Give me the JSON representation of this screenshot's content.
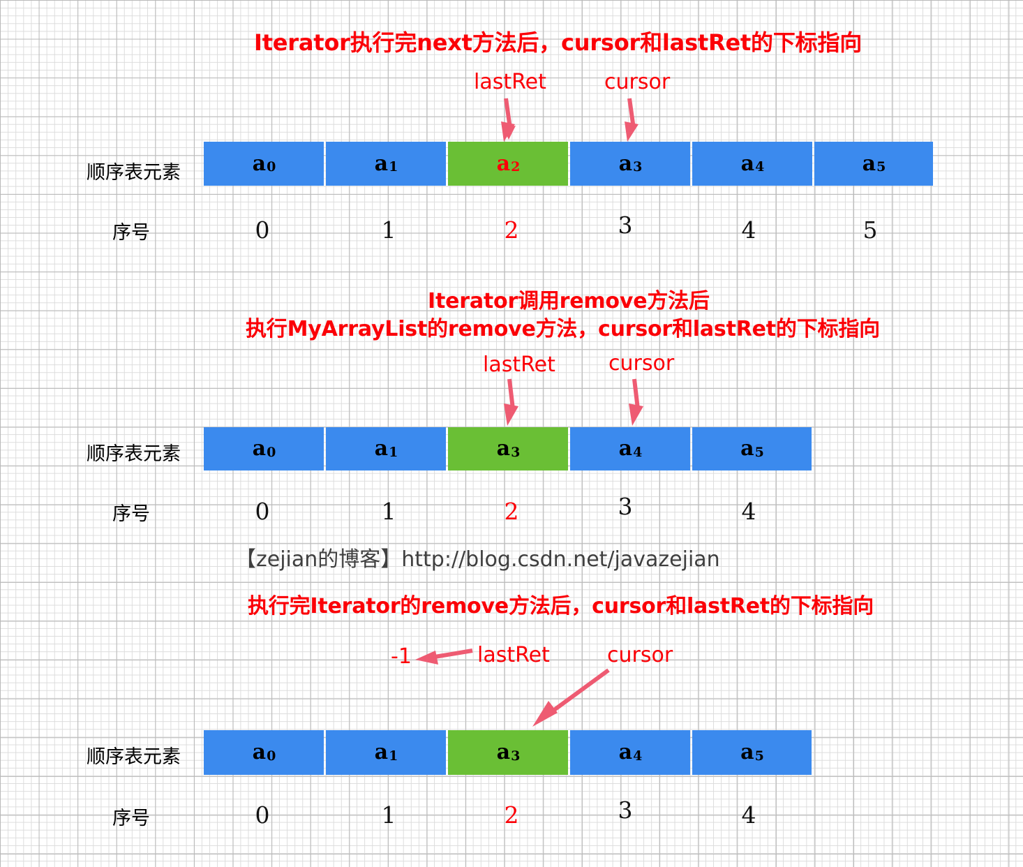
{
  "page": {
    "background": "graph-paper",
    "grid_color": "#dcdcdc",
    "grid_major_color": "#b9b9b9"
  },
  "colors": {
    "red_text": "#fb0007",
    "arrow": "#ee5b72",
    "cell_blue": "#3b8aee",
    "cell_green": "#6abf35",
    "label_black": "#000000",
    "credit_gray": "#3f3f3f"
  },
  "credit": {
    "text": "【zejian的博客】http://blog.csdn.net/javazejian"
  },
  "labels": {
    "elements_row": "顺序表元素",
    "index_row": "序号",
    "lastRet": "lastRet",
    "cursor": "cursor",
    "minus_one": "-1"
  },
  "sections": [
    {
      "id": "after-next",
      "heading_lines": [
        "Iterator执行完next方法后，cursor和lastRet的下标指向"
      ],
      "pointers": [
        {
          "name": "lastRet",
          "label": "lastRet",
          "target_index": 2
        },
        {
          "name": "cursor",
          "label": "cursor",
          "target_index": 3
        }
      ],
      "cells": [
        {
          "base": "a",
          "sub": "0",
          "color": "blue",
          "text_color": "black"
        },
        {
          "base": "a",
          "sub": "1",
          "color": "blue",
          "text_color": "black"
        },
        {
          "base": "a",
          "sub": "2",
          "color": "green",
          "text_color": "red"
        },
        {
          "base": "a",
          "sub": "3",
          "color": "blue",
          "text_color": "black"
        },
        {
          "base": "a",
          "sub": "4",
          "color": "blue",
          "text_color": "black"
        },
        {
          "base": "a",
          "sub": "5",
          "color": "blue",
          "text_color": "black"
        }
      ],
      "indices": [
        {
          "value": "0",
          "color": "black"
        },
        {
          "value": "1",
          "color": "black"
        },
        {
          "value": "2",
          "color": "red"
        },
        {
          "value": "3",
          "color": "black"
        },
        {
          "value": "4",
          "color": "black"
        },
        {
          "value": "5",
          "color": "black"
        }
      ]
    },
    {
      "id": "after-arraylist-remove",
      "heading_lines": [
        "Iterator调用remove方法后",
        "执行MyArrayList的remove方法，cursor和lastRet的下标指向"
      ],
      "pointers": [
        {
          "name": "lastRet",
          "label": "lastRet",
          "target_index": 2
        },
        {
          "name": "cursor",
          "label": "cursor",
          "target_index": 3
        }
      ],
      "cells": [
        {
          "base": "a",
          "sub": "0",
          "color": "blue",
          "text_color": "black"
        },
        {
          "base": "a",
          "sub": "1",
          "color": "blue",
          "text_color": "black"
        },
        {
          "base": "a",
          "sub": "3",
          "color": "green",
          "text_color": "black"
        },
        {
          "base": "a",
          "sub": "4",
          "color": "blue",
          "text_color": "black"
        },
        {
          "base": "a",
          "sub": "5",
          "color": "blue",
          "text_color": "black"
        }
      ],
      "indices": [
        {
          "value": "0",
          "color": "black"
        },
        {
          "value": "1",
          "color": "black"
        },
        {
          "value": "2",
          "color": "red"
        },
        {
          "value": "3",
          "color": "black"
        },
        {
          "value": "4",
          "color": "black"
        }
      ]
    },
    {
      "id": "after-iterator-remove",
      "heading_lines": [
        "执行完Iterator的remove方法后，cursor和lastRet的下标指向"
      ],
      "pointers": [
        {
          "name": "lastRet",
          "label": "lastRet",
          "target_value": "-1"
        },
        {
          "name": "cursor",
          "label": "cursor",
          "target_index": 2
        }
      ],
      "cells": [
        {
          "base": "a",
          "sub": "0",
          "color": "blue",
          "text_color": "black"
        },
        {
          "base": "a",
          "sub": "1",
          "color": "blue",
          "text_color": "black"
        },
        {
          "base": "a",
          "sub": "3",
          "color": "green",
          "text_color": "black"
        },
        {
          "base": "a",
          "sub": "4",
          "color": "blue",
          "text_color": "black"
        },
        {
          "base": "a",
          "sub": "5",
          "color": "blue",
          "text_color": "black"
        }
      ],
      "indices": [
        {
          "value": "0",
          "color": "black"
        },
        {
          "value": "1",
          "color": "black"
        },
        {
          "value": "2",
          "color": "red"
        },
        {
          "value": "3",
          "color": "black"
        },
        {
          "value": "4",
          "color": "black"
        }
      ]
    }
  ]
}
